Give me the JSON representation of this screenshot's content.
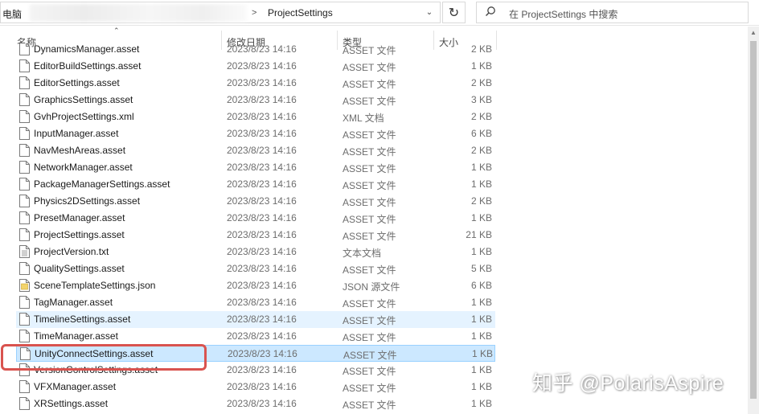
{
  "address_bar": {
    "root_label": "电脑",
    "separator": ">",
    "current_folder": "ProjectSettings",
    "dropdown_glyph": "⌄",
    "refresh_glyph": "↻"
  },
  "search": {
    "placeholder": "在 ProjectSettings 中搜索",
    "icon": "search-icon"
  },
  "columns": {
    "sort_glyph": "⌃",
    "name": "名称",
    "date": "修改日期",
    "type": "类型",
    "size": "大小"
  },
  "files": [
    {
      "name": "DynamicsManager.asset",
      "date": "2023/8/23 14:16",
      "type": "ASSET 文件",
      "size": "2 KB",
      "icon": "file-icon",
      "state": "normal"
    },
    {
      "name": "EditorBuildSettings.asset",
      "date": "2023/8/23 14:16",
      "type": "ASSET 文件",
      "size": "1 KB",
      "icon": "file-icon",
      "state": "normal"
    },
    {
      "name": "EditorSettings.asset",
      "date": "2023/8/23 14:16",
      "type": "ASSET 文件",
      "size": "2 KB",
      "icon": "file-icon",
      "state": "normal"
    },
    {
      "name": "GraphicsSettings.asset",
      "date": "2023/8/23 14:16",
      "type": "ASSET 文件",
      "size": "3 KB",
      "icon": "file-icon",
      "state": "normal"
    },
    {
      "name": "GvhProjectSettings.xml",
      "date": "2023/8/23 14:16",
      "type": "XML 文档",
      "size": "2 KB",
      "icon": "file-icon",
      "state": "normal"
    },
    {
      "name": "InputManager.asset",
      "date": "2023/8/23 14:16",
      "type": "ASSET 文件",
      "size": "6 KB",
      "icon": "file-icon",
      "state": "normal"
    },
    {
      "name": "NavMeshAreas.asset",
      "date": "2023/8/23 14:16",
      "type": "ASSET 文件",
      "size": "2 KB",
      "icon": "file-icon",
      "state": "normal"
    },
    {
      "name": "NetworkManager.asset",
      "date": "2023/8/23 14:16",
      "type": "ASSET 文件",
      "size": "1 KB",
      "icon": "file-icon",
      "state": "normal"
    },
    {
      "name": "PackageManagerSettings.asset",
      "date": "2023/8/23 14:16",
      "type": "ASSET 文件",
      "size": "1 KB",
      "icon": "file-icon",
      "state": "normal"
    },
    {
      "name": "Physics2DSettings.asset",
      "date": "2023/8/23 14:16",
      "type": "ASSET 文件",
      "size": "2 KB",
      "icon": "file-icon",
      "state": "normal"
    },
    {
      "name": "PresetManager.asset",
      "date": "2023/8/23 14:16",
      "type": "ASSET 文件",
      "size": "1 KB",
      "icon": "file-icon",
      "state": "normal"
    },
    {
      "name": "ProjectSettings.asset",
      "date": "2023/8/23 14:16",
      "type": "ASSET 文件",
      "size": "21 KB",
      "icon": "file-icon",
      "state": "normal"
    },
    {
      "name": "ProjectVersion.txt",
      "date": "2023/8/23 14:16",
      "type": "文本文档",
      "size": "1 KB",
      "icon": "text-file-icon",
      "state": "normal"
    },
    {
      "name": "QualitySettings.asset",
      "date": "2023/8/23 14:16",
      "type": "ASSET 文件",
      "size": "5 KB",
      "icon": "file-icon",
      "state": "normal"
    },
    {
      "name": "SceneTemplateSettings.json",
      "date": "2023/8/23 14:16",
      "type": "JSON 源文件",
      "size": "6 KB",
      "icon": "json-file-icon",
      "state": "normal"
    },
    {
      "name": "TagManager.asset",
      "date": "2023/8/23 14:16",
      "type": "ASSET 文件",
      "size": "1 KB",
      "icon": "file-icon",
      "state": "normal"
    },
    {
      "name": "TimelineSettings.asset",
      "date": "2023/8/23 14:16",
      "type": "ASSET 文件",
      "size": "1 KB",
      "icon": "file-icon",
      "state": "hover"
    },
    {
      "name": "TimeManager.asset",
      "date": "2023/8/23 14:16",
      "type": "ASSET 文件",
      "size": "1 KB",
      "icon": "file-icon",
      "state": "normal"
    },
    {
      "name": "UnityConnectSettings.asset",
      "date": "2023/8/23 14:16",
      "type": "ASSET 文件",
      "size": "1 KB",
      "icon": "file-icon",
      "state": "selected"
    },
    {
      "name": "VersionControlSettings.asset",
      "date": "2023/8/23 14:16",
      "type": "ASSET 文件",
      "size": "1 KB",
      "icon": "file-icon",
      "state": "normal"
    },
    {
      "name": "VFXManager.asset",
      "date": "2023/8/23 14:16",
      "type": "ASSET 文件",
      "size": "1 KB",
      "icon": "file-icon",
      "state": "normal"
    },
    {
      "name": "XRSettings.asset",
      "date": "2023/8/23 14:16",
      "type": "ASSET 文件",
      "size": "1 KB",
      "icon": "file-icon",
      "state": "normal"
    }
  ],
  "annotation": {
    "color": "#d9534f"
  },
  "colors": {
    "hover": "#e5f3ff",
    "selected": "#cce8ff",
    "selected_border": "#99d1ff"
  },
  "watermark": "知乎 @PolarisAspire"
}
